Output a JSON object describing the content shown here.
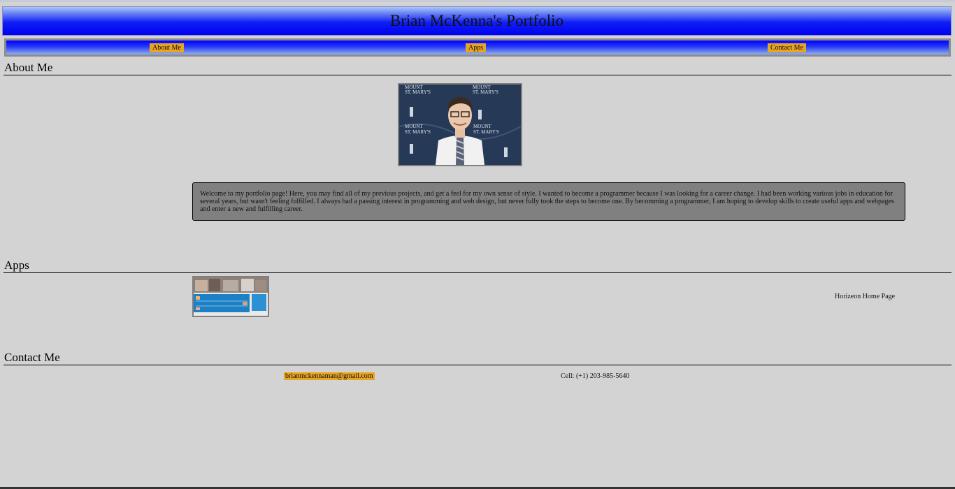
{
  "header": {
    "title": "Brian McKenna's Portfolio"
  },
  "nav": {
    "items": [
      {
        "label": "About Me"
      },
      {
        "label": "Apps"
      },
      {
        "label": "Contact Me"
      }
    ]
  },
  "about": {
    "heading": "About Me",
    "photo_icon": "profile-photo",
    "text": "Welcome to my portfolio page! Here, you may find all of my previous projects, and get a feel for my own sense of style. I wanted to become a programmer because I was looking for a career change. I had been working various jobs in education for several years, but wasn't feeling fulfilled. I always had a passing interest in programming and web design, but never fully took the steps to become one. By becomming a programmer, I am hoping to develop skills to create useful apps and webpages and enter a new and fulfilling career."
  },
  "apps": {
    "heading": "Apps",
    "items": [
      {
        "label": "Horizeon Home Page"
      }
    ]
  },
  "contact": {
    "heading": "Contact Me",
    "email": "brianmckennaman@gmail.com",
    "phone": "Cell: (+1) 203-985-5640"
  },
  "colors": {
    "page_bg": "#d3d3d3",
    "button_bg": "#e8a423",
    "header_blue": "#0000f0",
    "about_box_bg": "#808080"
  }
}
